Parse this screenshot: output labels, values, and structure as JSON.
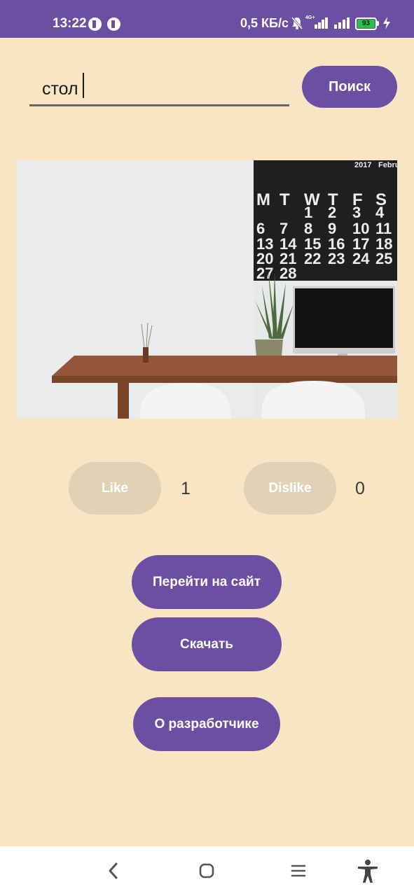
{
  "status_bar": {
    "time": "13:22",
    "network_speed": "0,5 КБ/с",
    "network_type": "4G+",
    "battery_level": "93",
    "icons": [
      "app-icon",
      "app-icon",
      "mute-icon",
      "signal-icon",
      "signal-icon",
      "battery-icon",
      "charging-icon"
    ],
    "colors": {
      "bar": "#6A4FA3",
      "battery": "#2BC04A"
    }
  },
  "search": {
    "value": "стол",
    "button_label": "Поиск"
  },
  "image": {
    "icon": "desk-photo"
  },
  "reactions": {
    "like_label": "Like",
    "like_count": "1",
    "dislike_label": "Dislike",
    "dislike_count": "0"
  },
  "actions": {
    "visit_label": "Перейти на сайт",
    "download_label": "Скачать",
    "about_label": "О разработчике"
  },
  "nav_bar": {
    "icons": [
      "back-icon",
      "home-icon",
      "menu-icon",
      "accessibility-icon"
    ]
  },
  "colors": {
    "background": "#F8E5C4",
    "accent": "#6A4FA3",
    "reaction_button": "#E2D2B5"
  }
}
